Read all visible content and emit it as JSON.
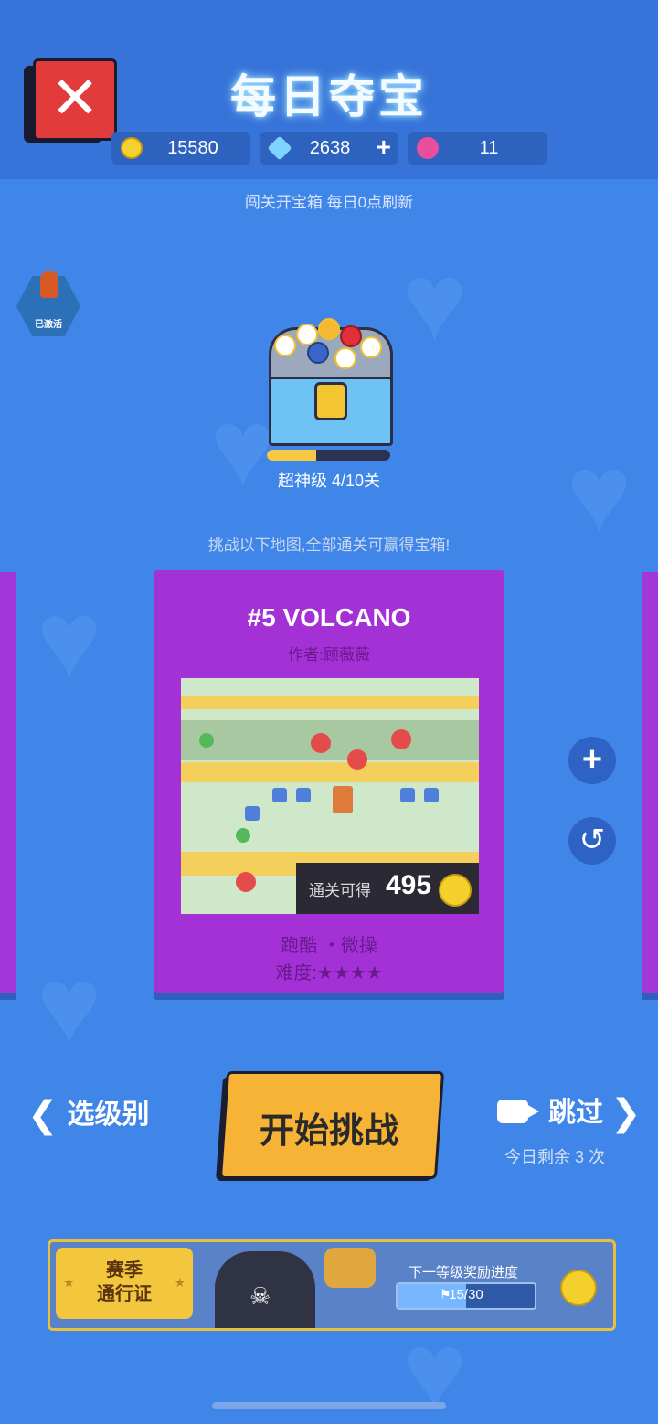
{
  "header": {
    "title": "每日夺宝",
    "subtitle": "闯关开宝箱 每日0点刷新",
    "close_icon": "close-x-icon"
  },
  "currencies": [
    {
      "icon": "gold-coin-icon",
      "value": "15580",
      "color": "#f5d130"
    },
    {
      "icon": "diamond-icon",
      "value": "2638",
      "color": "#7fd3ff",
      "has_plus": true
    },
    {
      "icon": "lotus-icon",
      "value": "11",
      "color": "#e94f9a"
    }
  ],
  "badge": {
    "label": "已激活"
  },
  "chest": {
    "progress": 0.4,
    "label": "超神级 4/10关"
  },
  "challenge_hint": "挑战以下地图,全部通关可赢得宝箱!",
  "level_card": {
    "title": "#5 VOLCANO",
    "author": "作者:顾薇薇",
    "reward_label": "通关可得",
    "reward_value": "495",
    "tags": "跑酷 ・微操",
    "difficulty": "难度:★★★★",
    "difficulty_stars": 4
  },
  "side_buttons": [
    {
      "icon": "plus-icon",
      "glyph": "+"
    },
    {
      "icon": "history-icon",
      "glyph": "↺"
    }
  ],
  "nav": {
    "prev_label": "选级别",
    "start_label": "开始挑战",
    "skip_label": "跳过",
    "remaining": "今日剩余 3 次"
  },
  "season_pass": {
    "tag": "赛季\n通行证",
    "next_label": "下一等级奖励进度",
    "progress_text": "15/30",
    "progress": 0.5
  },
  "colors": {
    "background": "#3f86e8",
    "card": "#a331d6",
    "start_button": "#f6b335"
  }
}
